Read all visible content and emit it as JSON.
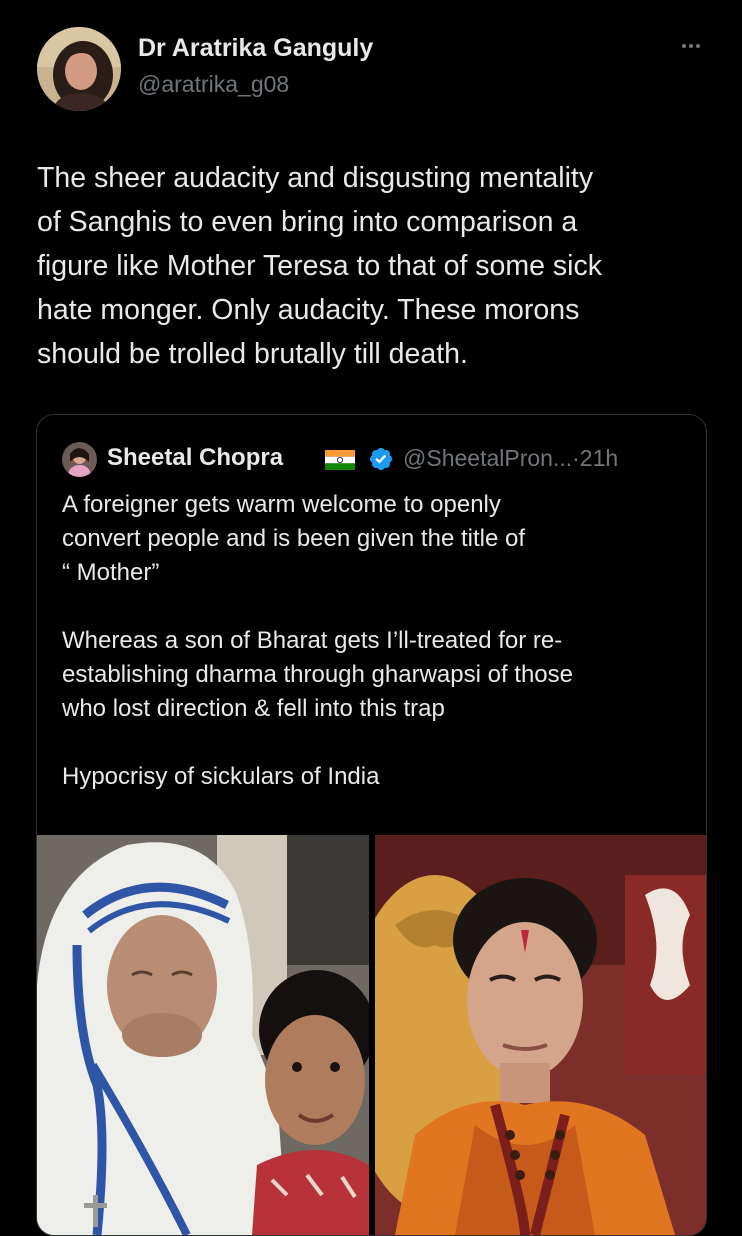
{
  "author": {
    "name": "Dr Aratrika Ganguly",
    "handle": "@aratrika_g08",
    "avatar_icon": "profile-photo"
  },
  "more_icon": "more-options-icon",
  "tweet": {
    "text_lines": [
      "The sheer audacity and disgusting mentality",
      "of Sanghis to even bring into comparison a",
      "figure like Mother Teresa to that of some sick",
      "hate monger. Only audacity. These morons",
      "should be trolled brutally till death."
    ]
  },
  "quoted": {
    "name": "Sheetal Chopra",
    "flag_icon": "india-flag-icon",
    "verified_icon": "verified-badge-icon",
    "handle": "@SheetalPron...",
    "separator": "·",
    "time": "21h",
    "text_lines": [
      "A foreigner gets warm welcome to openly",
      "convert people and is been given the title of",
      "“ Mother”",
      "",
      "Whereas a son of Bharat gets I’ll-treated  for re-",
      "establishing dharma through gharwapsi of those",
      "who lost direction & fell into this trap",
      "",
      "Hypocrisy of sickulars of India"
    ],
    "images": [
      {
        "name": "photo-nun-with-child",
        "alt_icon": "photo"
      },
      {
        "name": "photo-man-in-saffron",
        "alt_icon": "photo"
      }
    ]
  },
  "colors": {
    "background": "#000000",
    "text": "#e7e9ea",
    "secondary": "#71767b",
    "border": "#2f3336",
    "verified": "#1d9bf0",
    "flag_saffron": "#ff9933",
    "flag_green": "#138808",
    "flag_chakra": "#000080"
  }
}
